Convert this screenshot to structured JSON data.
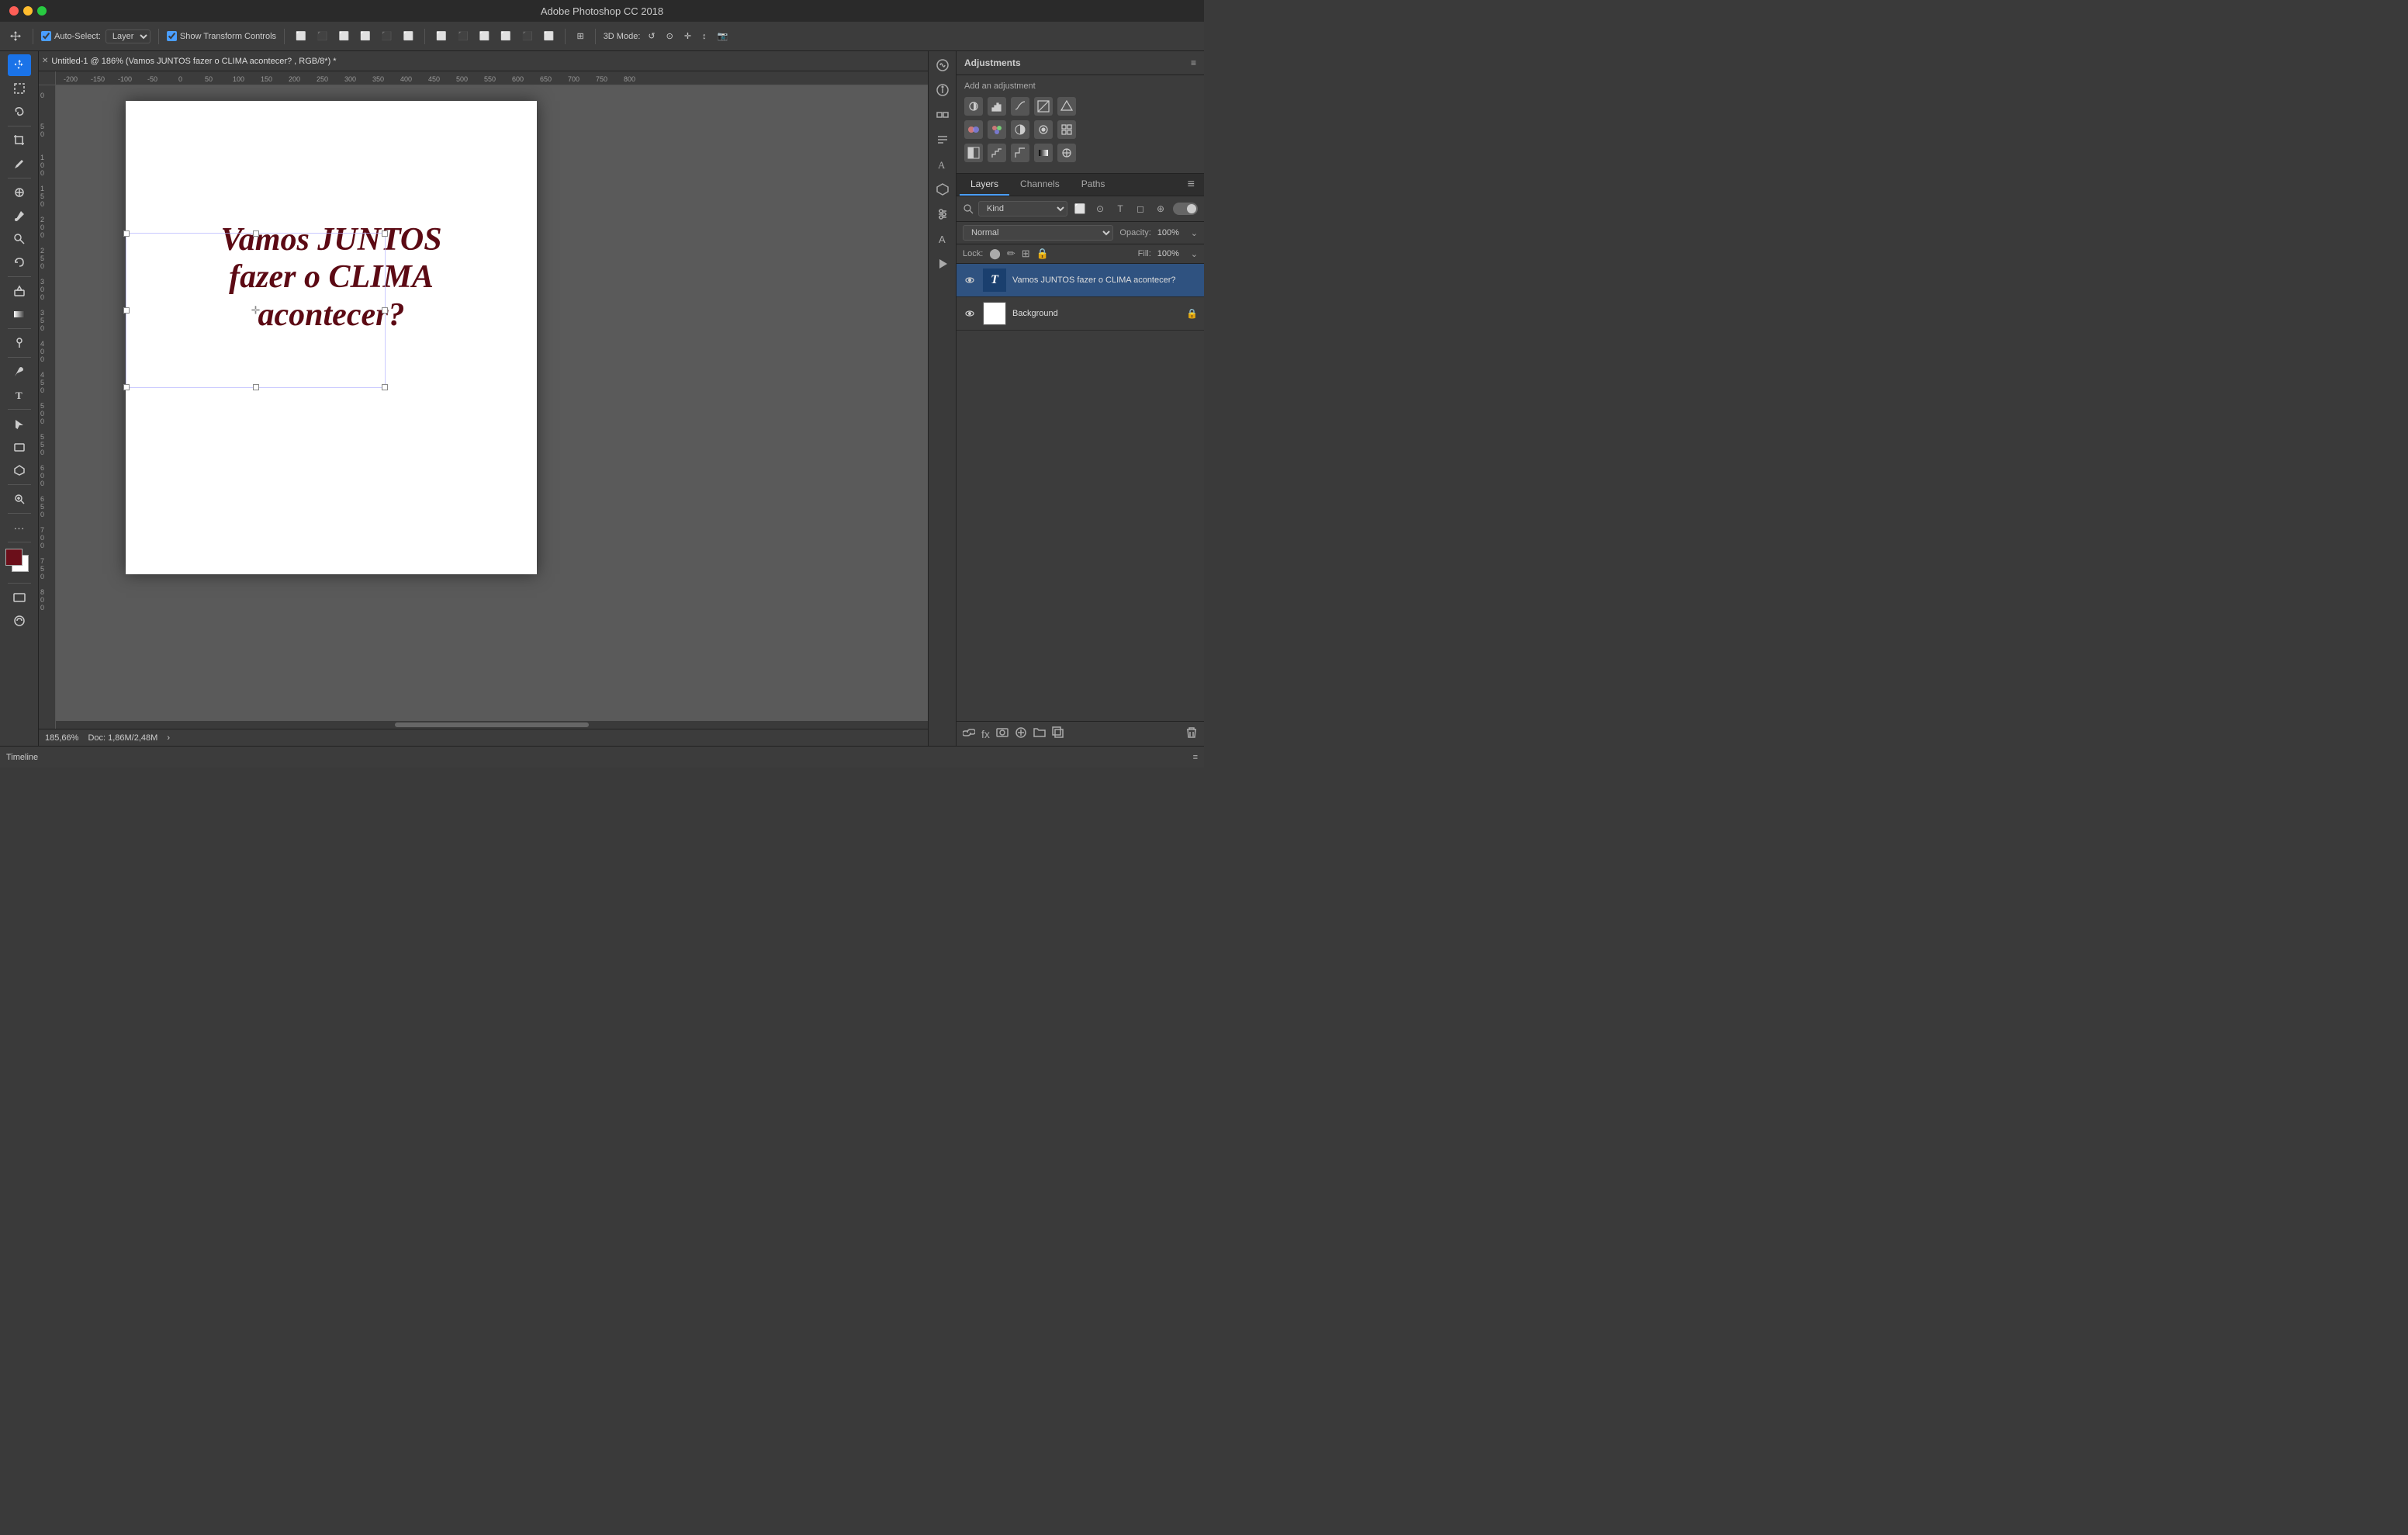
{
  "app": {
    "title": "Adobe Photoshop CC 2018",
    "window_controls": {
      "red": "close",
      "yellow": "minimize",
      "green": "maximize"
    }
  },
  "titlebar": {
    "title": "Adobe Photoshop CC 2018"
  },
  "toolbar": {
    "auto_select_label": "Auto-Select:",
    "layer_label": "Layer",
    "show_transform_controls": "Show Transform Controls",
    "three_d_mode": "3D Mode:"
  },
  "tab": {
    "title": "Untitled-1 @ 186% (Vamos JUNTOS fazer o CLIMA acontecer? , RGB/8*) *"
  },
  "canvas": {
    "text_line1": "Vamos JUNTOS",
    "text_line2": "fazer o CLIMA",
    "text_line3": "acontecer?"
  },
  "status_bar": {
    "zoom": "185,66%",
    "doc_info": "Doc: 1,86M/2,48M"
  },
  "timeline": {
    "label": "Timeline"
  },
  "adjustments_panel": {
    "title": "Adjustments",
    "add_label": "Add an adjustment"
  },
  "layers_panel": {
    "tabs": [
      {
        "label": "Layers",
        "active": true
      },
      {
        "label": "Channels",
        "active": false
      },
      {
        "label": "Paths",
        "active": false
      }
    ],
    "blend_mode": "Normal",
    "opacity_label": "Opacity:",
    "opacity_value": "100%",
    "lock_label": "Lock:",
    "fill_label": "Fill:",
    "fill_value": "100%",
    "layers": [
      {
        "name": "Vamos JUNTOS fazer o CLIMA acontecer?",
        "type": "text",
        "visible": true,
        "active": true
      },
      {
        "name": "Background",
        "type": "image",
        "visible": true,
        "locked": true,
        "active": false
      }
    ]
  },
  "ruler": {
    "h_ticks": [
      "-200",
      "-150",
      "-100",
      "-50",
      "0",
      "50",
      "100",
      "150",
      "200",
      "250",
      "300",
      "350",
      "400",
      "450",
      "500",
      "550",
      "600",
      "650",
      "700",
      "750",
      "800"
    ],
    "v_ticks": [
      "0",
      "50",
      "100",
      "150",
      "200",
      "250",
      "300",
      "350",
      "400",
      "450",
      "500",
      "550",
      "600",
      "650",
      "700",
      "750",
      "800"
    ]
  }
}
